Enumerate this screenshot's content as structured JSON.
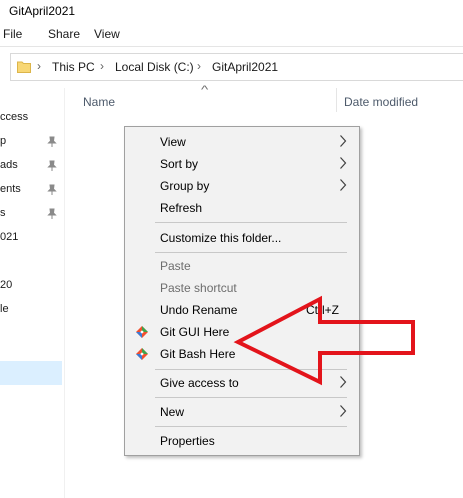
{
  "window": {
    "title": "GitApril2021"
  },
  "ribbon": {
    "tabs": [
      "File",
      "Share",
      "View"
    ]
  },
  "address": {
    "crumbs": [
      "This PC",
      "Local Disk (C:)",
      "GitApril2021"
    ]
  },
  "nav": {
    "items": [
      {
        "label": "ccess",
        "pinned": false
      },
      {
        "label": "p",
        "pinned": true
      },
      {
        "label": "ads",
        "pinned": true
      },
      {
        "label": "ents",
        "pinned": true
      },
      {
        "label": "s",
        "pinned": true
      },
      {
        "label": "021",
        "pinned": false
      },
      {
        "label": "20",
        "pinned": false
      },
      {
        "label": "le",
        "pinned": false
      }
    ]
  },
  "columns": {
    "name": "Name",
    "date": "Date modified"
  },
  "context_menu": {
    "items": [
      {
        "label": "View",
        "submenu": true
      },
      {
        "label": "Sort by",
        "submenu": true
      },
      {
        "label": "Group by",
        "submenu": true
      },
      {
        "label": "Refresh"
      },
      {
        "label": "Customize this folder..."
      },
      {
        "label": "Paste",
        "disabled": true
      },
      {
        "label": "Paste shortcut",
        "disabled": true
      },
      {
        "label": "Undo Rename",
        "shortcut": "Ctrl+Z"
      },
      {
        "label": "Git GUI Here",
        "icon": "git-gui-icon"
      },
      {
        "label": "Git Bash Here",
        "icon": "git-bash-icon"
      },
      {
        "label": "Give access to",
        "submenu": true
      },
      {
        "label": "New",
        "submenu": true
      },
      {
        "label": "Properties"
      }
    ]
  },
  "annotation": {
    "arrow_color": "#e3141b"
  }
}
